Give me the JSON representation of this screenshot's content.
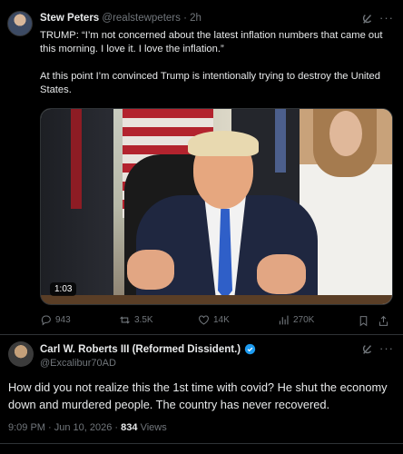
{
  "post": {
    "author_name": "Stew Peters",
    "author_handle": "@realstewpeters",
    "time": "· 2h",
    "text_p1": "TRUMP: “I’m not concerned about the latest inflation numbers that came out this morning. I love it. I love the inflation.”",
    "text_p2": "At this point I’m convinced Trump is intentionally trying to destroy the United States.",
    "video_duration": "1:03",
    "replies": "943",
    "reposts": "3.5K",
    "likes": "14K",
    "views": "270K"
  },
  "reply": {
    "author_name": "Carl W. Roberts III (Reformed Dissident.)",
    "author_handle": "@Excalibur70AD",
    "text": "How did you not realize this the 1st time with covid? He shut the economy down and murdered people. The country has never recovered.",
    "time": "9:09 PM",
    "date": "· Jun 10, 2026 ·",
    "views_count": "834",
    "views_label": "Views"
  },
  "colors": {
    "background": "#000000",
    "text": "#e7e9ea",
    "muted": "#71767b",
    "verified": "#1d9bf0"
  },
  "icons": [
    "grok-icon",
    "more-icon",
    "reply-icon",
    "repost-icon",
    "like-icon",
    "views-icon",
    "bookmark-icon",
    "share-icon",
    "verified-icon"
  ]
}
